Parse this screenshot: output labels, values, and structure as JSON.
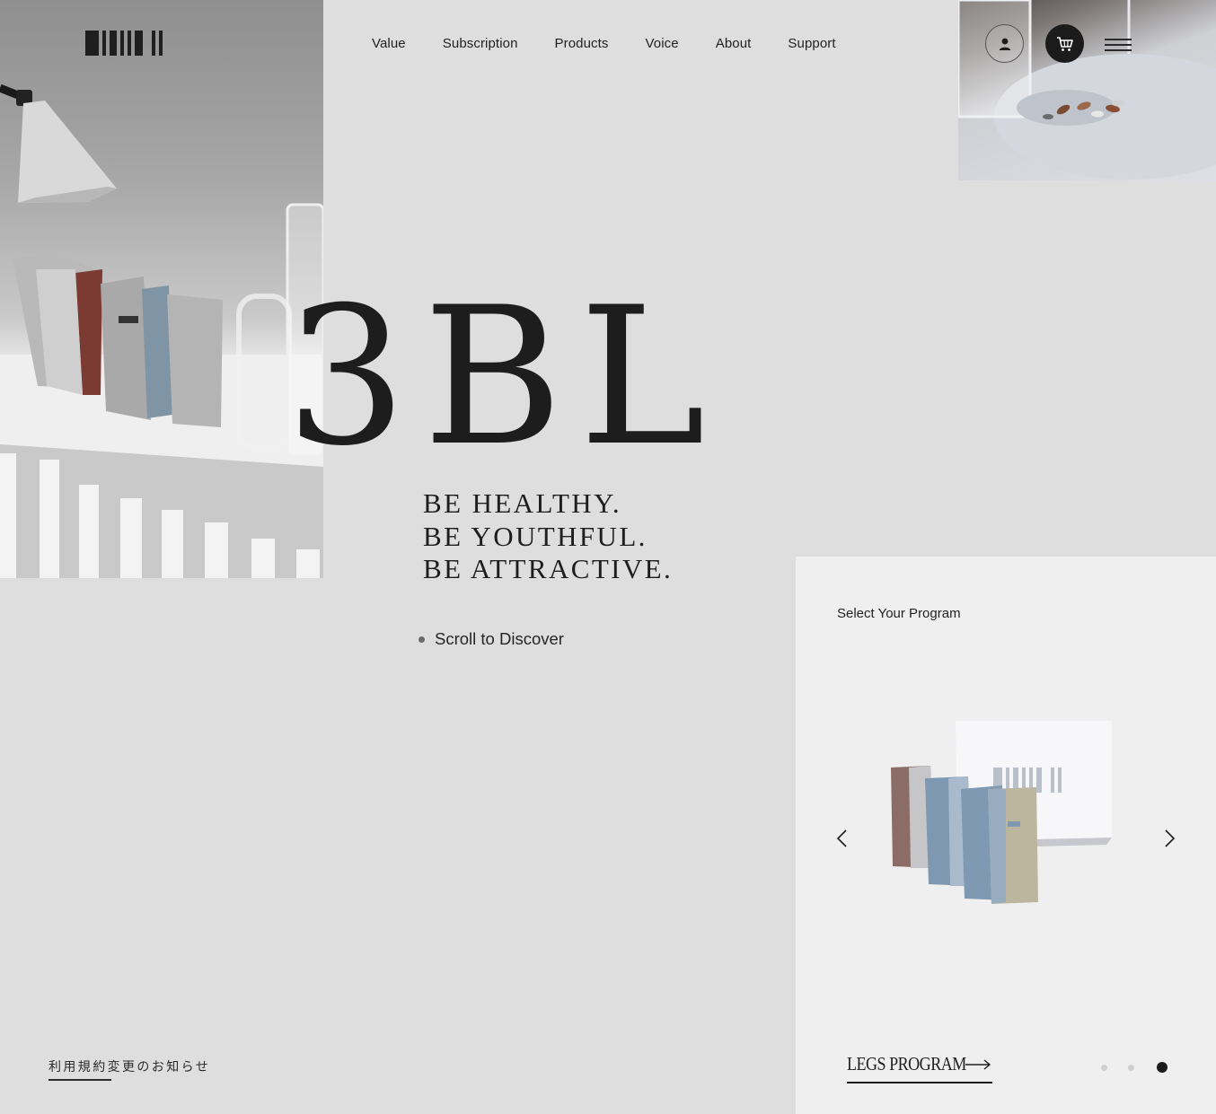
{
  "nav": {
    "items": [
      {
        "label": "Value"
      },
      {
        "label": "Subscription"
      },
      {
        "label": "Products"
      },
      {
        "label": "Voice"
      },
      {
        "label": "About"
      },
      {
        "label": "Support"
      }
    ]
  },
  "header": {
    "account_icon": "user-icon",
    "cart_icon": "cart-icon",
    "menu_icon": "hamburger-menu-icon"
  },
  "hero": {
    "brand": "3BL",
    "tagline": [
      "BE HEALTHY.",
      "BE YOUTHFUL.",
      "BE ATTRACTIVE."
    ],
    "scroll_text": "Scroll to Discover"
  },
  "notice": {
    "text": "利用規約変更のお知らせ"
  },
  "program_panel": {
    "title": "Select Your Program",
    "program_label": "LEGS PROGRAM",
    "slide_count": 3,
    "active_slide": 3
  },
  "colors": {
    "background": "#dedede",
    "panel": "#efefef",
    "text": "#1e1e1e",
    "cart_button": "#1b1b1b"
  }
}
